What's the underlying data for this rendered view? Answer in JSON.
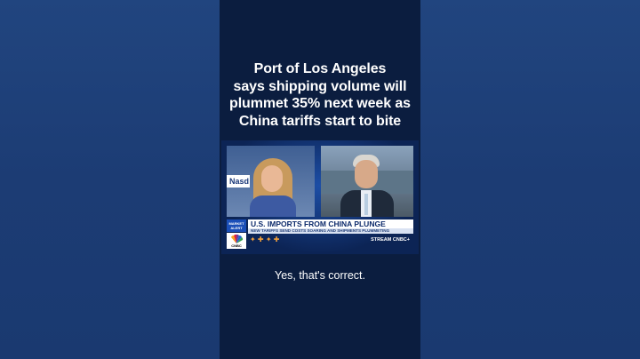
{
  "headline": {
    "lines": [
      "Port of Los Angeles",
      "says shipping volume will",
      "plummet 35% next week as",
      "China tariffs start to bite"
    ]
  },
  "video": {
    "anchor_sign": "Nasd",
    "alert_badge": "MARKET ALERT",
    "logo": "CNBC",
    "ticker_main": "U.S. IMPORTS FROM CHINA PLUNGE",
    "ticker_sub": "NEW TARIFFS SEND COSTS SOARING AND SHIPMENTS PLUMMETING",
    "stream_label": "STREAM CNBC+"
  },
  "caption": "Yes, that's correct.",
  "colors": {
    "background": "#1e3f78",
    "panel": "#0b1d3f",
    "accent": "#1b4fb8"
  },
  "icons": [
    "cnbc-peacock-icon"
  ]
}
